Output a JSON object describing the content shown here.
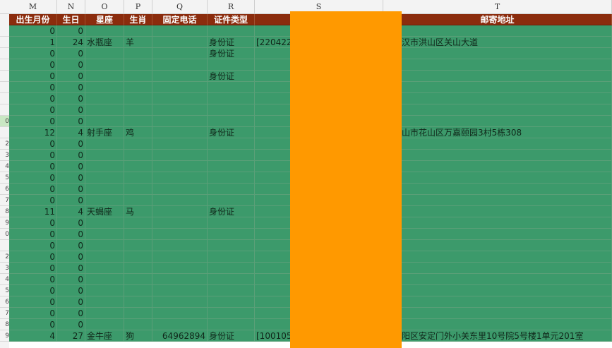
{
  "columns": [
    "M",
    "N",
    "O",
    "P",
    "Q",
    "R",
    "S",
    "T"
  ],
  "headers": [
    "出生月份",
    "生日",
    "星座",
    "生肖",
    "固定电话",
    "证件类型",
    "",
    "邮寄地址"
  ],
  "row_numbers": [
    "",
    "",
    "",
    "",
    "",
    "",
    "",
    "",
    "0",
    "",
    "2",
    "3",
    "4",
    "5",
    "6",
    "7",
    "8",
    "9",
    "0",
    "",
    "2",
    "3",
    "4",
    "5",
    "6",
    "7",
    "8",
    "9"
  ],
  "rows": [
    [
      "0",
      "0",
      "",
      "",
      "",
      "",
      "",
      ""
    ],
    [
      "1",
      "24",
      "水瓶座",
      "羊",
      "",
      "身份证",
      "[220422",
      "省武汉市洪山区关山大道"
    ],
    [
      "0",
      "0",
      "",
      "",
      "",
      "身份证",
      "",
      ""
    ],
    [
      "0",
      "0",
      "",
      "",
      "",
      "",
      "",
      ""
    ],
    [
      "0",
      "0",
      "",
      "",
      "",
      "身份证",
      "",
      ""
    ],
    [
      "0",
      "0",
      "",
      "",
      "",
      "",
      "",
      ""
    ],
    [
      "0",
      "0",
      "",
      "",
      "",
      "",
      "",
      ""
    ],
    [
      "0",
      "0",
      "",
      "",
      "",
      "",
      "",
      ""
    ],
    [
      "0",
      "0",
      "",
      "",
      "",
      "",
      "",
      ""
    ],
    [
      "12",
      "4",
      "射手座",
      "鸡",
      "",
      "身份证",
      "",
      "马鞍山市花山区万嘉颐园3村5栋308"
    ],
    [
      "0",
      "0",
      "",
      "",
      "",
      "",
      "",
      ""
    ],
    [
      "0",
      "0",
      "",
      "",
      "",
      "",
      "",
      ""
    ],
    [
      "0",
      "0",
      "",
      "",
      "",
      "",
      "",
      ""
    ],
    [
      "0",
      "0",
      "",
      "",
      "",
      "",
      "",
      ""
    ],
    [
      "0",
      "0",
      "",
      "",
      "",
      "",
      "",
      ""
    ],
    [
      "0",
      "0",
      "",
      "",
      "",
      "",
      "",
      ""
    ],
    [
      "11",
      "4",
      "天蝎座",
      "马",
      "",
      "身份证",
      "",
      ""
    ],
    [
      "0",
      "0",
      "",
      "",
      "",
      "",
      "",
      ""
    ],
    [
      "0",
      "0",
      "",
      "",
      "",
      "",
      "",
      ""
    ],
    [
      "0",
      "0",
      "",
      "",
      "",
      "",
      "",
      ""
    ],
    [
      "0",
      "0",
      "",
      "",
      "",
      "",
      "",
      ""
    ],
    [
      "0",
      "0",
      "",
      "",
      "",
      "",
      "",
      ""
    ],
    [
      "0",
      "0",
      "",
      "",
      "",
      "",
      "",
      ""
    ],
    [
      "0",
      "0",
      "",
      "",
      "",
      "",
      "",
      ""
    ],
    [
      "0",
      "0",
      "",
      "",
      "",
      "",
      "",
      ""
    ],
    [
      "0",
      "0",
      "",
      "",
      "",
      "",
      "",
      ""
    ],
    [
      "0",
      "0",
      "",
      "",
      "",
      "",
      "",
      ""
    ],
    [
      "4",
      "27",
      "金牛座",
      "狗",
      "64962894",
      "身份证",
      "[100105",
      "市朝阳区安定门外小关东里10号院5号楼1单元201室"
    ]
  ],
  "colors": {
    "header_bg": "#8b2c0d",
    "cell_bg": "#3c9a6b",
    "redaction": "#ff9900"
  }
}
